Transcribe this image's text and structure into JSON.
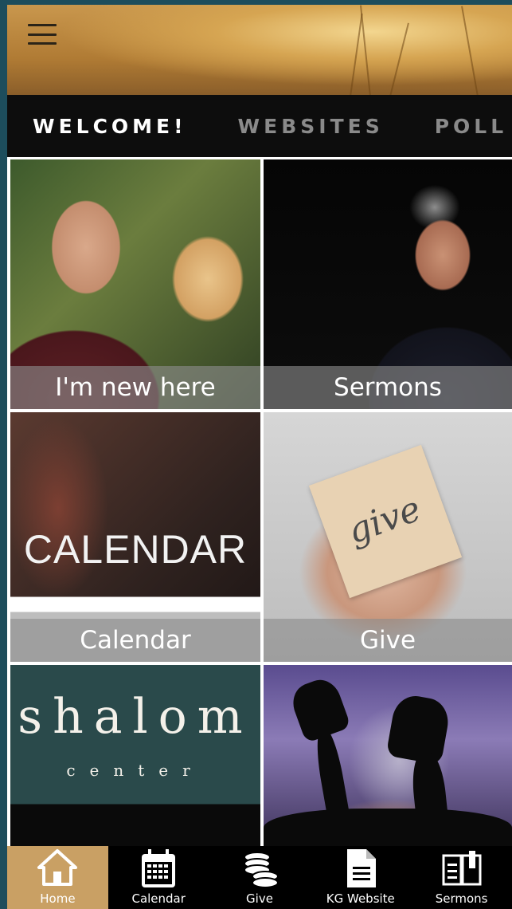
{
  "header": {
    "menu_icon": "hamburger-menu-icon"
  },
  "tabs": [
    {
      "label": "WELCOME!",
      "active": true
    },
    {
      "label": "WEBSITES",
      "active": false
    },
    {
      "label": "POLL",
      "active": false
    }
  ],
  "tiles": [
    {
      "caption": "I'm new here"
    },
    {
      "caption": "Sermons"
    },
    {
      "caption": "Calendar",
      "image_text": "CALENDAR"
    },
    {
      "caption": "Give",
      "image_text": "give"
    },
    {
      "caption": "",
      "image_text": "shalom",
      "image_subtext": "center"
    },
    {
      "caption": ""
    }
  ],
  "bottom_nav": [
    {
      "label": "Home",
      "icon": "home-icon",
      "active": true
    },
    {
      "label": "Calendar",
      "icon": "calendar-icon",
      "active": false
    },
    {
      "label": "Give",
      "icon": "coins-stack-icon",
      "active": false
    },
    {
      "label": "KG Website",
      "icon": "document-icon",
      "active": false
    },
    {
      "label": "Sermons",
      "icon": "open-book-icon",
      "active": false
    }
  ],
  "colors": {
    "nav_active_bg": "#c9a064",
    "tab_active": "#ffffff",
    "tab_inactive": "#8a8a8a",
    "page_border": "#1d4d5c"
  }
}
